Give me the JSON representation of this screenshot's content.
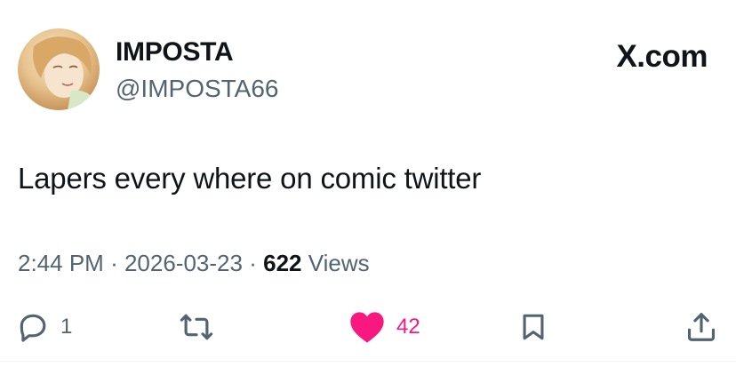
{
  "user": {
    "display_name": "IMPOSTA",
    "handle": "@IMPOSTA66"
  },
  "brand": "X.com",
  "tweet": {
    "text": "Lapers every where on comic twitter",
    "time": "2:44 PM",
    "separator": "·",
    "date": "2026-03-23",
    "views_count": "622",
    "views_label": "Views"
  },
  "actions": {
    "reply_count": "1",
    "like_count": "42"
  },
  "colors": {
    "like": "#f91880",
    "secondary_text": "#536471",
    "primary_text": "#0f1419"
  },
  "icons": {
    "reply": "reply-icon",
    "retweet": "retweet-icon",
    "like": "heart-icon",
    "bookmark": "bookmark-icon",
    "share": "share-icon"
  }
}
